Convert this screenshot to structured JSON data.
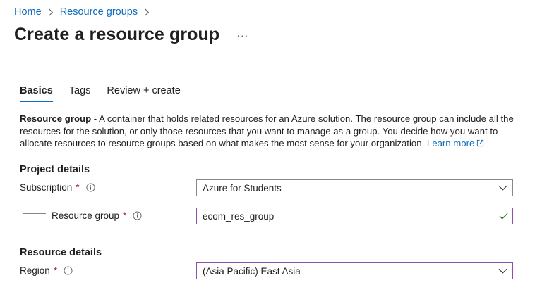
{
  "breadcrumb": {
    "home": "Home",
    "resource_groups": "Resource groups"
  },
  "page": {
    "title": "Create a resource group",
    "more": "···"
  },
  "tabs": [
    {
      "label": "Basics",
      "active": true
    },
    {
      "label": "Tags",
      "active": false
    },
    {
      "label": "Review + create",
      "active": false
    }
  ],
  "description": {
    "bold": "Resource group",
    "text": " - A container that holds related resources for an Azure solution. The resource group can include all the resources for the solution, or only those resources that you want to manage as a group. You decide how you want to allocate resources to resource groups based on what makes the most sense for your organization. ",
    "link": "Learn more"
  },
  "project_details": {
    "title": "Project details",
    "subscription": {
      "label": "Subscription",
      "required": "*",
      "value": "Azure for Students"
    },
    "resource_group": {
      "label": "Resource group",
      "required": "*",
      "value": "ecom_res_group"
    }
  },
  "resource_details": {
    "title": "Resource details",
    "region": {
      "label": "Region",
      "required": "*",
      "value": "(Asia Pacific) East Asia"
    }
  },
  "colors": {
    "link": "#0f6cbd",
    "required": "#a4262c",
    "valid": "#107c10",
    "focus_border": "#8a4fb0"
  }
}
